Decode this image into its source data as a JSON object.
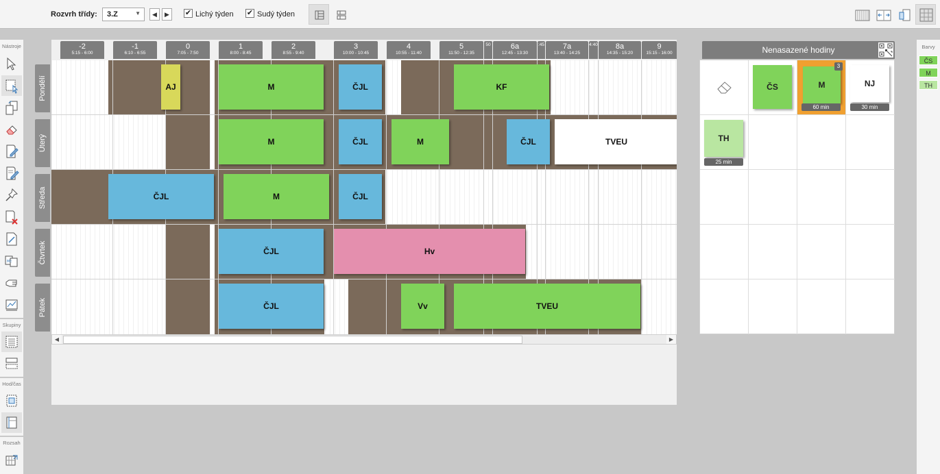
{
  "toolbar": {
    "class_label": "Rozvrh třídy:",
    "class_value": "3.Z",
    "prev_icon": "chevron-left-icon",
    "next_icon": "chevron-right-icon",
    "odd_week_label": "Lichý týden",
    "odd_week_checked": true,
    "even_week_label": "Sudý týden",
    "even_week_checked": true
  },
  "tools": {
    "group_tools": "Nástroje",
    "group_groups": "Skupiny",
    "group_time": "Hod/čas",
    "group_range": "Rozsah"
  },
  "timetable": {
    "periods": [
      {
        "num": "-2",
        "time": "5:15 - 6:00"
      },
      {
        "num": "-1",
        "time": "6:10 - 6:55"
      },
      {
        "num": "0",
        "time": "7:05 - 7:50"
      },
      {
        "num": "1",
        "time": "8:00 - 8:45"
      },
      {
        "num": "2",
        "time": "8:55 - 9:40"
      },
      {
        "num": "3",
        "time": "10:00 - 10:45"
      },
      {
        "num": "4",
        "time": "10:55 - 11:40"
      },
      {
        "num": "5",
        "time": "11:50 - 12:35"
      },
      {
        "num": "",
        "time": "50"
      },
      {
        "num": "6a",
        "time": "12:45 - 13:30"
      },
      {
        "num": "",
        "time": ":45"
      },
      {
        "num": "7a",
        "time": "13:40 - 14:25"
      },
      {
        "num": "",
        "time": "4:40"
      },
      {
        "num": "8a",
        "time": "14:35 - 15:20"
      },
      {
        "num": "9",
        "time": "15:15 - 16:00"
      }
    ],
    "days": [
      "Pondělí",
      "Úterý",
      "Středa",
      "Čtvrtek",
      "Pátek"
    ],
    "lessons": {
      "mon": [
        "AJ",
        "M",
        "ČJL",
        "KF"
      ],
      "tue": [
        "M",
        "ČJL",
        "M",
        "ČJL",
        "TVEU"
      ],
      "wed": [
        "ČJL",
        "M",
        "ČJL"
      ],
      "thu": [
        "ČJL",
        "Hv"
      ],
      "fri": [
        "ČJL",
        "Vv",
        "TVEU"
      ]
    }
  },
  "unplaced": {
    "title": "Nenasazené hodiny",
    "eraser_icon": "eraser-icon",
    "cards": [
      {
        "label": "ČS"
      },
      {
        "label": "M",
        "duration": "60 min",
        "count": "3"
      },
      {
        "label": "NJ",
        "duration": "30 min"
      },
      {
        "label": "TH",
        "duration": "25 min"
      }
    ]
  },
  "colors": {
    "title": "Barvy",
    "items": [
      "ČS",
      "M",
      "TH"
    ]
  },
  "palette": {
    "green": "#80d35a",
    "blue": "#67b8dc",
    "pink": "#e48fae",
    "yellow": "#d8d85a",
    "light_green": "#b9e6a1",
    "busy": "#7b6a5a"
  }
}
